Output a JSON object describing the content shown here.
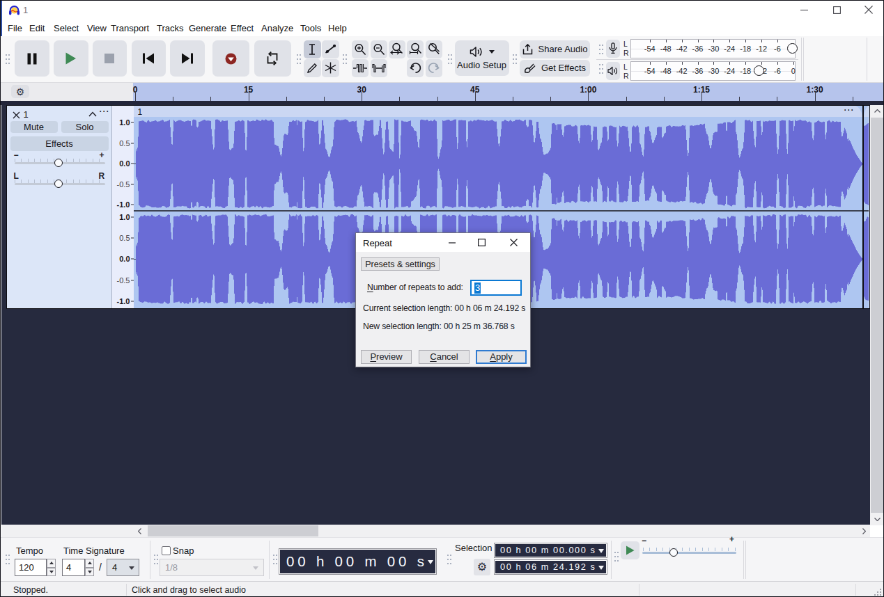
{
  "window": {
    "title": "1"
  },
  "menu": {
    "items": [
      "File",
      "Edit",
      "Select",
      "View",
      "Transport",
      "Tracks",
      "Generate",
      "Effect",
      "Analyze",
      "Tools",
      "Help"
    ]
  },
  "toolbar": {
    "audio_setup_label": "Audio Setup",
    "share_audio_label": "Share Audio",
    "get_effects_label": "Get Effects"
  },
  "meters": {
    "left": "L",
    "right": "R",
    "record": {
      "labels": [
        "-54",
        "-48",
        "-42",
        "-36",
        "-30",
        "-24",
        "-18",
        "-12",
        "-6"
      ]
    },
    "playback": {
      "labels": [
        "-54",
        "-48",
        "-42",
        "-36",
        "-30",
        "-24",
        "-18",
        "-12",
        "-6",
        "0"
      ]
    }
  },
  "timeline": {
    "labels": [
      "0",
      "15",
      "30",
      "45",
      "1:00",
      "1:15",
      "1:30"
    ]
  },
  "track": {
    "name": "1",
    "mute": "Mute",
    "solo": "Solo",
    "effects": "Effects",
    "gain_min": "−",
    "gain_max": "+",
    "pan_left": "L",
    "pan_right": "R",
    "scale": [
      "1.0",
      "0.5",
      "0.0",
      "-0.5",
      "-1.0"
    ],
    "clip_name": "1",
    "clip_menu": "⋯"
  },
  "waveform": {
    "seed": 20,
    "background": "#aec6f1",
    "color": "#6a6cd6",
    "zero_line": "#3a3a4e",
    "separator": "#17171e",
    "clip_edge": "#0d0d13"
  },
  "dialog": {
    "title": "Repeat",
    "presets_button": "Presets & settings",
    "repeats_label": "Number of repeats to add:",
    "repeats_value": "3",
    "current_length": "Current selection length: 00 h 06 m 24.192 s",
    "new_length": "New selection length: 00 h 25 m 36.768 s",
    "preview": "Preview",
    "cancel": "Cancel",
    "apply": "Apply"
  },
  "footer": {
    "tempo_label": "Tempo",
    "tempo_value": "120",
    "time_signature_label": "Time Signature",
    "ts_upper": "4",
    "ts_slash": "/",
    "ts_lower": "4",
    "snap_label": "Snap",
    "snap_value": "1/8",
    "time_display": "00 h 00 m 00 s",
    "selection_label": "Selection",
    "selection_start": "00 h 00 m 00.000 s",
    "selection_end": "00 h 06 m 24.192 s",
    "speed_min": "−",
    "speed_max": "+"
  },
  "status": {
    "state": "Stopped.",
    "hint": "Click and drag to select audio"
  }
}
